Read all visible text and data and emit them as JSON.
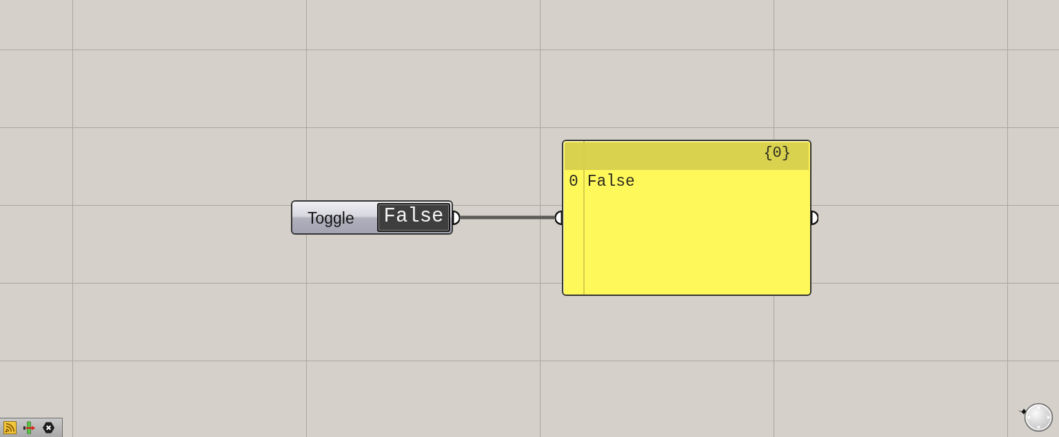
{
  "toggle": {
    "label": "Toggle",
    "value": "False"
  },
  "panel": {
    "branch": "{0}",
    "rows": [
      {
        "index": "0",
        "value": "False"
      }
    ]
  }
}
